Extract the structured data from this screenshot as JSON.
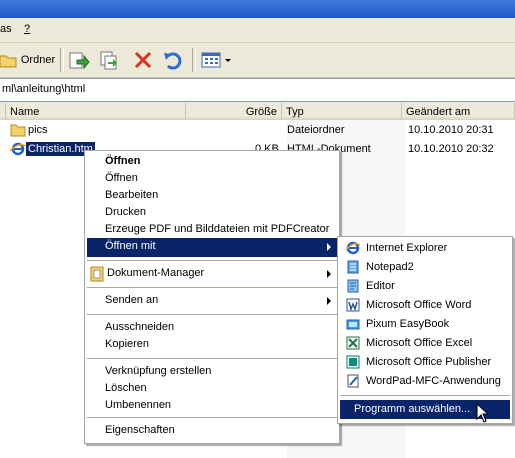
{
  "menubar": {
    "items": [
      "as",
      "?"
    ]
  },
  "toolbar": {
    "folders_label": "Ordner"
  },
  "address": {
    "value": "ml\\anleitung\\html"
  },
  "list": {
    "columns": [
      "Name",
      "Größe",
      "Typ",
      "Geändert am"
    ],
    "rows": [
      {
        "name": "pics",
        "size": "",
        "type": "Dateiordner",
        "modified": "10.10.2010 20:31"
      },
      {
        "name": "Christian.htm",
        "size": "0 KB",
        "type": "HTML-Dokument",
        "modified": "10.10.2010 20:32"
      }
    ]
  },
  "context_menu": {
    "items": [
      "Öffnen",
      "Öffnen",
      "Bearbeiten",
      "Drucken",
      "Erzeuge PDF und Bilddateien mit PDFCreator",
      "Öffnen mit",
      "Dokument-Manager",
      "Senden an",
      "Ausschneiden",
      "Kopieren",
      "Verknüpfung erstellen",
      "Löschen",
      "Umbenennen",
      "Eigenschaften"
    ]
  },
  "open_with_menu": {
    "items": [
      "Internet Explorer",
      "Notepad2",
      "Editor",
      "Microsoft Office Word",
      "Pixum EasyBook",
      "Microsoft Office Excel",
      "Microsoft Office Publisher",
      "WordPad-MFC-Anwendung",
      "Programm auswählen..."
    ]
  },
  "colors": {
    "selection": "#0a246a",
    "face": "#ece9d8",
    "title": "#2458c8"
  },
  "icons": [
    "folder-icon",
    "move-to-icon",
    "copy-to-icon",
    "delete-icon",
    "undo-icon",
    "views-icon",
    "ie-file-icon"
  ]
}
